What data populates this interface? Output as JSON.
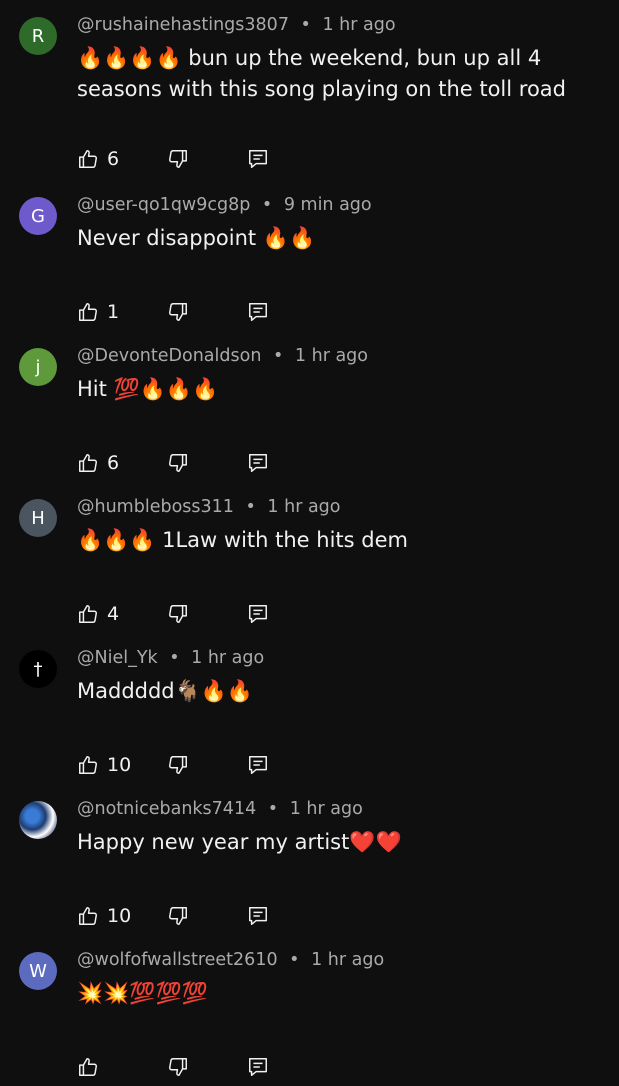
{
  "colors": {
    "background": "#0f0f0f",
    "text": "#f1f1f1",
    "meta": "#aaaaaa"
  },
  "comments": [
    {
      "avatar_letter": "R",
      "avatar_color": "#2e6b2a",
      "author": "@rushainehastings3807",
      "time": "1 hr ago",
      "text": "🔥🔥🔥🔥 bun up the weekend, bun up all 4 seasons with this song playing on the toll road",
      "likes": "6"
    },
    {
      "avatar_letter": "G",
      "avatar_color": "#6f5acb",
      "author": "@user-qo1qw9cg8p",
      "time": "9 min ago",
      "text": "Never disappoint 🔥🔥",
      "likes": "1"
    },
    {
      "avatar_letter": "j",
      "avatar_color": "#5e9a3b",
      "author": "@DevonteDonaldson",
      "time": "1 hr ago",
      "text": "Hit 💯🔥🔥🔥",
      "likes": "6"
    },
    {
      "avatar_letter": "H",
      "avatar_color": "#4a5560",
      "author": "@humbleboss311",
      "time": "1 hr ago",
      "text": "🔥🔥🔥 1Law with the hits dem",
      "likes": "4"
    },
    {
      "avatar_letter": "†",
      "avatar_color": "#000000",
      "author": "@Niel_Yk",
      "time": "1 hr ago",
      "text": "Maddddd🐐🔥🔥",
      "likes": "10"
    },
    {
      "avatar_letter": "",
      "avatar_color": "#1e3c72",
      "author": "@notnicebanks7414",
      "time": "1 hr ago",
      "text": "Happy new year my artist❤️❤️",
      "likes": "10"
    },
    {
      "avatar_letter": "W",
      "avatar_color": "#5c6bc0",
      "author": "@wolfofwallstreet2610",
      "time": "1 hr ago",
      "text": "💥💥💯💯💯",
      "likes": ""
    }
  ],
  "icons": {
    "like": "thumbs-up-icon",
    "dislike": "thumbs-down-icon",
    "reply": "reply-comment-icon"
  }
}
